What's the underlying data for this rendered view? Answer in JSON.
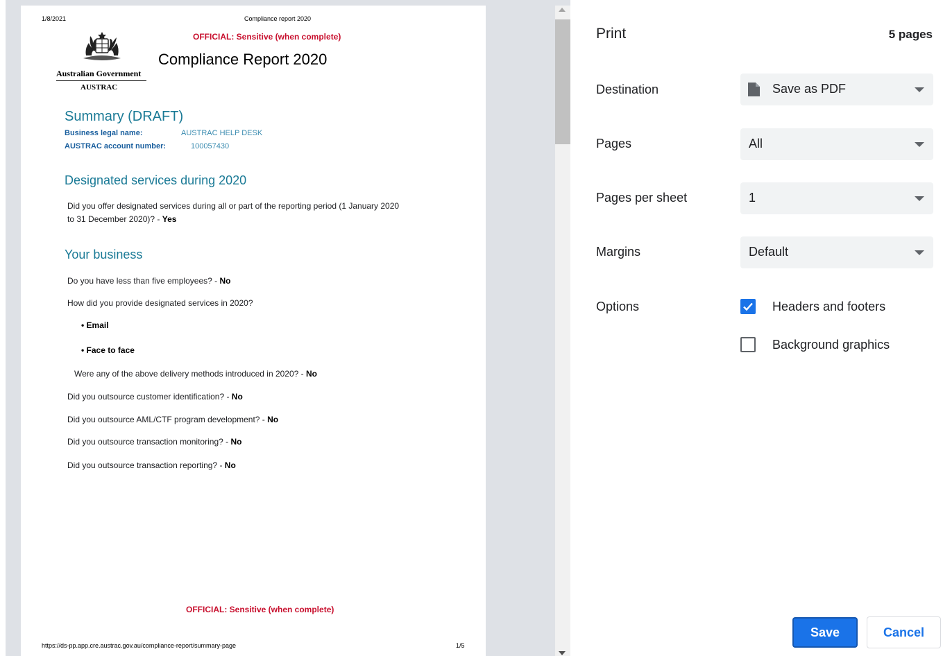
{
  "preview": {
    "header_date": "1/8/2021",
    "header_title": "Compliance report 2020",
    "classification_top": "OFFICIAL: Sensitive (when complete)",
    "logo_text_line1": "Australian Government",
    "logo_text_line2": "AUSTRAC",
    "report_title": "Compliance Report 2020",
    "summary_title": "Summary (DRAFT)",
    "business_legal_name_label": "Business legal name:",
    "business_legal_name_value": "AUSTRAC HELP DESK",
    "account_number_label": "AUSTRAC account number:",
    "account_number_value": "100057430",
    "section_designated": "Designated services during 2020",
    "q_designated_line1": "Did you offer designated services during all or part of the reporting period (1 January 2020",
    "q_designated_line2": "to 31 December 2020)? - ",
    "a_designated": "Yes",
    "section_business": "Your business",
    "q_employees": "Do you have less than five employees? - ",
    "a_employees": "No",
    "q_how_provide": "How did you provide designated services in 2020?",
    "methods": [
      "Email",
      "Face to face"
    ],
    "q_delivery_intro": "Were any of the above delivery methods introduced in 2020? - ",
    "a_delivery_intro": "No",
    "q_outsource_cid": "Did you outsource customer identification? - ",
    "a_outsource_cid": "No",
    "q_outsource_aml": "Did you outsource AML/CTF program development? - ",
    "a_outsource_aml": "No",
    "q_outsource_tm": "Did you outsource transaction monitoring? - ",
    "a_outsource_tm": "No",
    "q_outsource_tr": "Did you outsource transaction reporting? - ",
    "a_outsource_tr": "No",
    "classification_bottom": "OFFICIAL: Sensitive (when complete)",
    "footer_url": "https://ds-pp.app.cre.austrac.gov.au/compliance-report/summary-page",
    "footer_page": "1/5"
  },
  "print_panel": {
    "title": "Print",
    "page_count": "5 pages",
    "destination_label": "Destination",
    "destination_value": "Save as PDF",
    "destination_icon": "document-icon",
    "pages_label": "Pages",
    "pages_value": "All",
    "pages_per_sheet_label": "Pages per sheet",
    "pages_per_sheet_value": "1",
    "margins_label": "Margins",
    "margins_value": "Default",
    "options_label": "Options",
    "headers_footers_label": "Headers and footers",
    "headers_footers_checked": true,
    "background_graphics_label": "Background graphics",
    "background_graphics_checked": false,
    "save_label": "Save",
    "cancel_label": "Cancel"
  },
  "colors": {
    "accent": "#1a73e8",
    "official_red": "#c8102e",
    "heading_teal": "#1a7a96"
  }
}
